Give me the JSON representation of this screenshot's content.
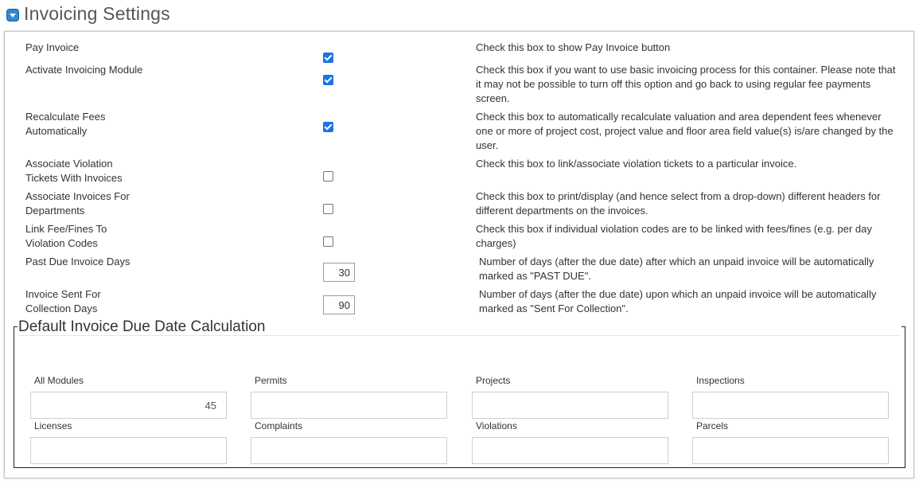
{
  "header": {
    "title": "Invoicing Settings",
    "icon": "collapse-toggle-icon"
  },
  "settings": [
    {
      "label": "Pay Invoice",
      "description": "Check this box to show Pay Invoice button",
      "type": "checkbox",
      "checked": true
    },
    {
      "label": "Activate Invoicing Module",
      "description": "Check this box if you want to use basic invoicing process for this container. Please note that it may not be possible to turn off this option and go back to using regular fee payments screen.",
      "type": "checkbox",
      "checked": true
    },
    {
      "label": "Recalculate Fees Automatically",
      "description": "Check this box to automatically recalculate valuation and area dependent fees whenever one or more of project cost, project value and floor area field value(s) is/are changed by the user.",
      "type": "checkbox",
      "checked": true
    },
    {
      "label": "Associate Violation Tickets With Invoices",
      "description": "Check this box to link/associate violation tickets to a particular invoice.",
      "type": "checkbox",
      "checked": false
    },
    {
      "label": "Associate Invoices For Departments",
      "description": "Check this box to print/display (and hence select from a drop-down) different headers for different departments on the invoices.",
      "type": "checkbox",
      "checked": false
    },
    {
      "label": "Link Fee/Fines To Violation Codes",
      "description": "Check this box if individual violation codes are to be linked with fees/fines (e.g. per day charges)",
      "type": "checkbox",
      "checked": false
    },
    {
      "label": "Past Due Invoice Days",
      "description": "Number of days (after the due date) after which an unpaid invoice will be automatically marked as \"PAST DUE\".",
      "type": "number",
      "value": "30"
    },
    {
      "label": "Invoice Sent For Collection Days",
      "description": "Number of days (after the due date) upon which an unpaid invoice will be automatically marked as \"Sent For Collection\".",
      "type": "number",
      "value": "90"
    }
  ],
  "due_date": {
    "legend": "Default Invoice Due Date Calculation",
    "fields": [
      {
        "label": "All Modules",
        "value": "45"
      },
      {
        "label": "Permits",
        "value": ""
      },
      {
        "label": "Projects",
        "value": ""
      },
      {
        "label": "Inspections",
        "value": ""
      },
      {
        "label": "Licenses",
        "value": ""
      },
      {
        "label": "Complaints",
        "value": ""
      },
      {
        "label": "Violations",
        "value": ""
      },
      {
        "label": "Parcels",
        "value": ""
      }
    ]
  },
  "colors": {
    "checkbox_accent": "#1a73e8",
    "header_icon": "#2e8bd6"
  }
}
